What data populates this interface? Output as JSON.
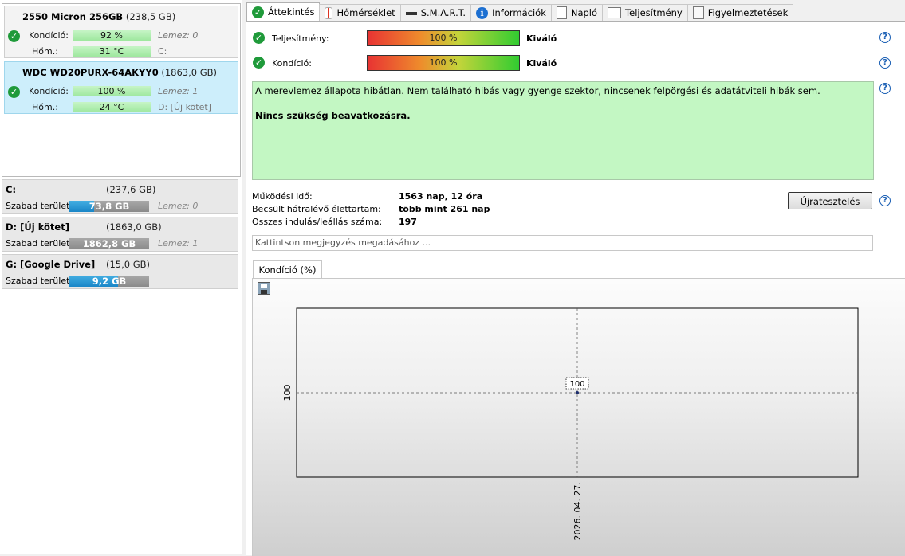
{
  "disks": [
    {
      "name": "2550 Micron 256GB",
      "size": "(238,5 GB)",
      "health_label": "Kondíció:",
      "health_value": "92 %",
      "health_side": "Lemez: 0",
      "temp_label": "Hőm.:",
      "temp_value": "31 °C",
      "temp_side": "C:",
      "selected": false
    },
    {
      "name": "WDC WD20PURX-64AKYY0",
      "size": "(1863,0 GB)",
      "health_label": "Kondíció:",
      "health_value": "100 %",
      "health_side": "Lemez: 1",
      "temp_label": "Hőm.:",
      "temp_value": "24 °C",
      "temp_side": "D: [Új kötet]",
      "selected": true
    }
  ],
  "volumes": [
    {
      "name": "C:",
      "size": "(237,6 GB)",
      "free_label": "Szabad terület",
      "free_value": "73,8 GB",
      "free_fraction": 0.31,
      "side": "Lemez: 0"
    },
    {
      "name": "D: [Új kötet]",
      "size": "(1863,0 GB)",
      "free_label": "Szabad terület",
      "free_value": "1862,8 GB",
      "free_fraction": 0.0,
      "side": "Lemez: 1"
    },
    {
      "name": "G: [Google Drive]",
      "size": "(15,0 GB)",
      "free_label": "Szabad terület",
      "free_value": "9,2 GB",
      "free_fraction": 0.61,
      "side": ""
    }
  ],
  "tabs": [
    {
      "label": "Áttekintés",
      "icon": "check-icon",
      "active": true
    },
    {
      "label": "Hőmérséklet",
      "icon": "thermometer-icon",
      "active": false
    },
    {
      "label": "S.M.A.R.T.",
      "icon": "smart-icon",
      "active": false
    },
    {
      "label": "Információk",
      "icon": "info-icon",
      "active": false
    },
    {
      "label": "Napló",
      "icon": "document-icon",
      "active": false
    },
    {
      "label": "Teljesítmény",
      "icon": "chart-icon",
      "active": false
    },
    {
      "label": "Figyelmeztetések",
      "icon": "warning-doc-icon",
      "active": false
    }
  ],
  "overview": {
    "performance": {
      "label": "Teljesítmény:",
      "value": "100 %",
      "rating": "Kiváló"
    },
    "health": {
      "label": "Kondíció:",
      "value": "100 %",
      "rating": "Kiváló"
    },
    "description": "A merevlemez állapota hibátlan. Nem található hibás vagy gyenge szektor, nincsenek felpörgési és adatátviteli hibák sem.",
    "recommendation": "Nincs szükség beavatkozásra.",
    "info": [
      {
        "label": "Működési idő:",
        "value": "1563 nap, 12 óra"
      },
      {
        "label": "Becsült hátralévő élettartam:",
        "value": "több mint 261 nap"
      },
      {
        "label": "Összes indulás/leállás száma:",
        "value": "197"
      }
    ],
    "retest_label": "Újratesztelés",
    "note_placeholder": "Kattintson megjegyzés megadásához ...",
    "chart_tab_label": "Kondíció  (%)"
  },
  "chart_data": {
    "type": "line",
    "title": "",
    "x": [
      "2026. 04. 27."
    ],
    "series": [
      {
        "values": [
          100
        ]
      }
    ],
    "point_labels": [
      "100"
    ],
    "y_tick_labels": [
      "100"
    ],
    "x_tick_labels": [
      "2026. 04. 27."
    ],
    "grid": true,
    "legend": "none"
  },
  "colors": {
    "selected_disk": "#cdeefb",
    "status_box": "#c3f7c3",
    "ok_check": "#1f9a3a",
    "free_bar": "#1a86c7"
  }
}
